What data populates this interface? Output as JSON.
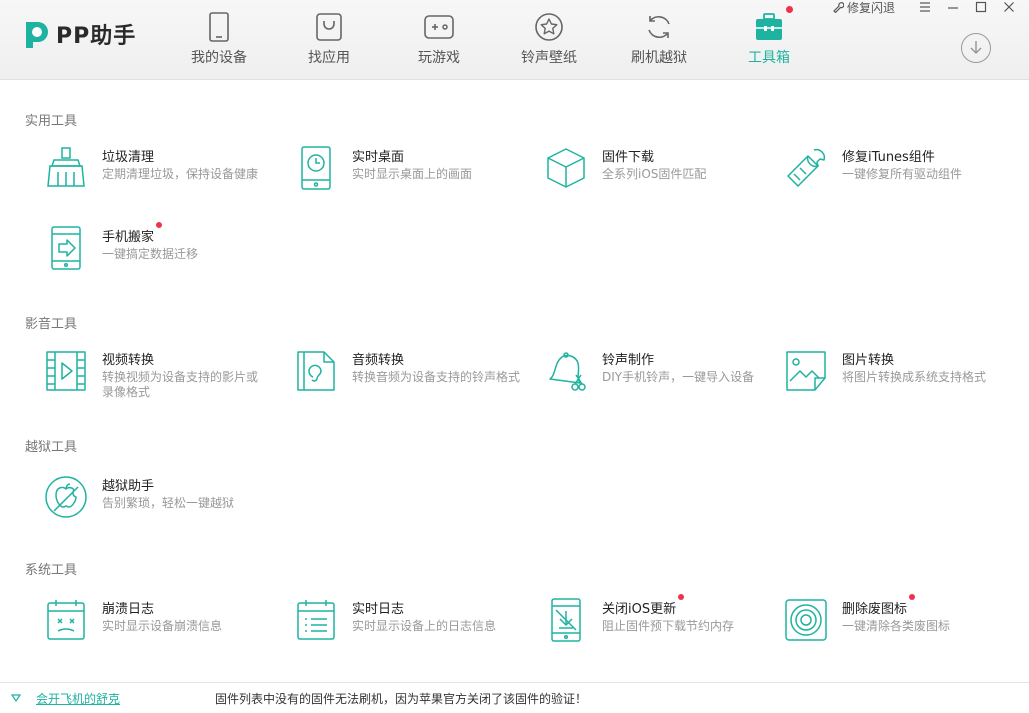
{
  "app": {
    "name": "PP助手"
  },
  "nav": {
    "tabs": [
      {
        "label": "我的设备"
      },
      {
        "label": "找应用"
      },
      {
        "label": "玩游戏"
      },
      {
        "label": "铃声壁纸"
      },
      {
        "label": "刷机越狱"
      },
      {
        "label": "工具箱",
        "active": true
      }
    ]
  },
  "window": {
    "repair_label": "修复闪退"
  },
  "sections": [
    {
      "title": "实用工具",
      "tools": [
        {
          "name": "垃圾清理",
          "desc": "定期清理垃圾，保持设备健康",
          "icon": "broom-icon"
        },
        {
          "name": "实时桌面",
          "desc": "实时显示桌面上的画面",
          "icon": "phone-clock-icon"
        },
        {
          "name": "固件下载",
          "desc": "全系列iOS固件匹配",
          "icon": "cube-icon"
        },
        {
          "name": "修复iTunes组件",
          "desc": "一键修复所有驱动组件",
          "icon": "wrench-icon"
        },
        {
          "name": "手机搬家",
          "desc": "一键搞定数据迁移",
          "icon": "phone-transfer-icon",
          "new": true
        }
      ]
    },
    {
      "title": "影音工具",
      "tools": [
        {
          "name": "视频转换",
          "desc": "转换视频为设备支持的影片或录像格式",
          "icon": "film-icon"
        },
        {
          "name": "音频转换",
          "desc": "转换音频为设备支持的铃声格式",
          "icon": "audio-file-icon"
        },
        {
          "name": "铃声制作",
          "desc": "DIY手机铃声，一键导入设备",
          "icon": "bell-icon"
        },
        {
          "name": "图片转换",
          "desc": "将图片转换成系统支持格式",
          "icon": "image-icon"
        }
      ]
    },
    {
      "title": "越狱工具",
      "tools": [
        {
          "name": "越狱助手",
          "desc": "告别繁琐，轻松一键越狱",
          "icon": "apple-icon"
        }
      ]
    },
    {
      "title": "系统工具",
      "tools": [
        {
          "name": "崩溃日志",
          "desc": "实时显示设备崩溃信息",
          "icon": "crash-calendar-icon"
        },
        {
          "name": "实时日志",
          "desc": "实时显示设备上的日志信息",
          "icon": "log-calendar-icon"
        },
        {
          "name": "关闭iOS更新",
          "desc": "阻止固件预下载节约内存",
          "icon": "phone-download-icon",
          "new": true
        },
        {
          "name": "删除废图标",
          "desc": "一键清除各类废图标",
          "icon": "target-icon",
          "new": true
        }
      ]
    }
  ],
  "footer": {
    "link": "会开飞机的舒克",
    "notice": "固件列表中没有的固件无法刷机，因为苹果官方关闭了该固件的验证！"
  },
  "colors": {
    "accent": "#1eb3a0",
    "dot": "#f0324b"
  }
}
